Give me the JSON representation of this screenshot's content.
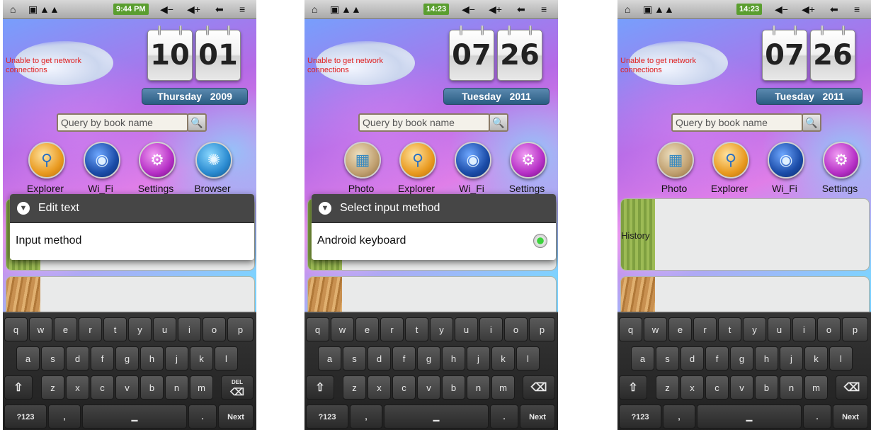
{
  "common": {
    "network_message": "Unable to get network connections",
    "search_placeholder": "Query by book name",
    "history_label": "History",
    "status_icons": [
      "home-icon",
      "usb-icon",
      "warning-icon",
      "warning-icon",
      "battery-icon",
      "volume-down-icon",
      "volume-up-icon",
      "back-icon",
      "menu-icon"
    ],
    "keyboard": {
      "row1": [
        "q",
        "w",
        "e",
        "r",
        "t",
        "y",
        "u",
        "i",
        "o",
        "p"
      ],
      "row2": [
        "a",
        "s",
        "d",
        "f",
        "g",
        "h",
        "j",
        "k",
        "l"
      ],
      "row3": [
        "z",
        "x",
        "c",
        "v",
        "b",
        "n",
        "m"
      ],
      "shift": "⇧",
      "delete_glyph": "⌫",
      "delete_small": "DEL",
      "symbols": "?123",
      "comma": ",",
      "space": "▁",
      "period": ".",
      "next": "Next"
    },
    "colors": {
      "status_time_bg": "#5a9e2f",
      "date_bar": "#2a5c82",
      "dialog_header": "#464646"
    }
  },
  "screens": [
    {
      "time": "9:44 PM",
      "clock_hour": "10",
      "clock_minute": "01",
      "day": "Thursday",
      "year": "2009",
      "apps": [
        {
          "label": "Explorer",
          "icon": "explorer-icon"
        },
        {
          "label": "Wi_Fi",
          "icon": "wifi-icon"
        },
        {
          "label": "Settings",
          "icon": "settings-icon"
        },
        {
          "label": "Browser",
          "icon": "browser-icon"
        }
      ],
      "dialog": {
        "title": "Edit text",
        "item": "Input method"
      }
    },
    {
      "time": "14:23",
      "clock_hour": "07",
      "clock_minute": "26",
      "day": "Tuesday",
      "year": "2011",
      "apps": [
        {
          "label": "Photo",
          "icon": "photo-icon"
        },
        {
          "label": "Explorer",
          "icon": "explorer-icon"
        },
        {
          "label": "Wi_Fi",
          "icon": "wifi-icon"
        },
        {
          "label": "Settings",
          "icon": "settings-icon"
        }
      ],
      "dialog": {
        "title": "Select input method",
        "item": "Android keyboard",
        "selected": true
      }
    },
    {
      "time": "14:23",
      "clock_hour": "07",
      "clock_minute": "26",
      "day": "Tuesday",
      "year": "2011",
      "apps": [
        {
          "label": "Photo",
          "icon": "photo-icon"
        },
        {
          "label": "Explorer",
          "icon": "explorer-icon"
        },
        {
          "label": "Wi_Fi",
          "icon": "wifi-icon"
        },
        {
          "label": "Settings",
          "icon": "settings-icon"
        }
      ]
    }
  ]
}
